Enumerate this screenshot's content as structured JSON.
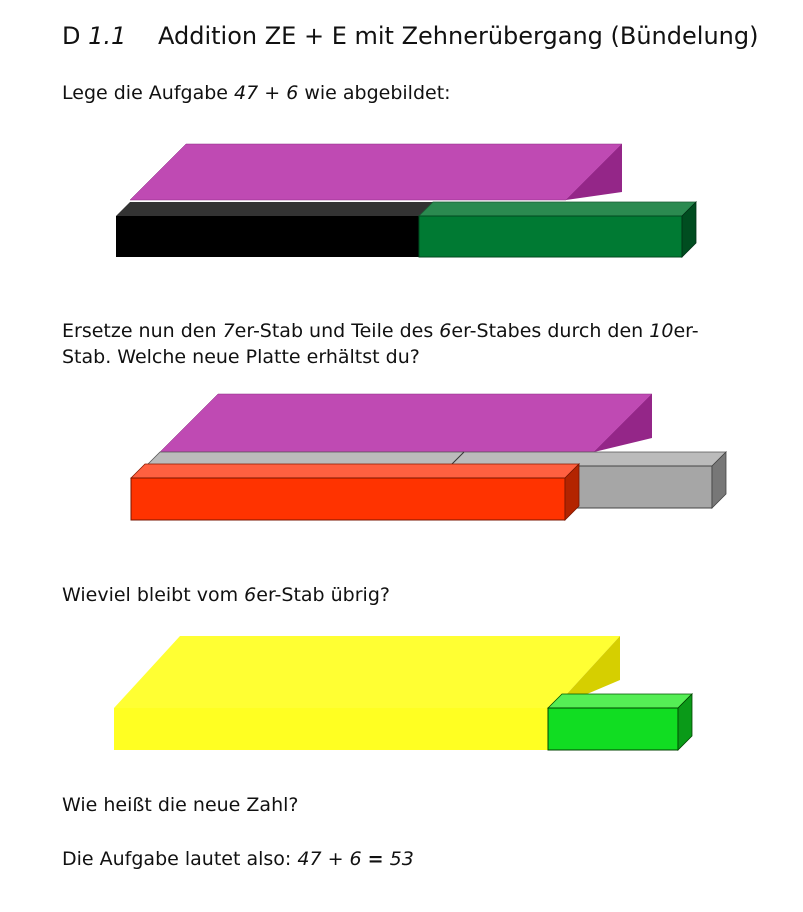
{
  "title": {
    "code_letter": "D",
    "code_number": "1.1",
    "text": "Addition ZE + E mit Zehnerübergang (Bündelung)"
  },
  "step1": {
    "instruction_prefix": "Lege die Aufgabe",
    "task": "47 + 6",
    "instruction_suffix": "wie abgebildet:"
  },
  "step2": {
    "line1_prefix": "Ersetze nun den",
    "seven": "7",
    "line1_mid": "er-Stab und Teile des",
    "six": "6",
    "line1_mid2": "er-Stabes durch den",
    "ten": "10",
    "line1_suffix": "er-",
    "line2": "Stab. Welche neue Platte erhältst du?"
  },
  "step3": {
    "question_prefix": "Wieviel bleibt vom",
    "six": "6",
    "question_suffix": "er-Stab übrig?"
  },
  "step4": {
    "question": "Wie heißt die neue Zahl?"
  },
  "result": {
    "prefix": "Die Aufgabe lautet also:",
    "task": "47 + 6",
    "equals": "=",
    "answer": "53"
  },
  "colors": {
    "ten_plate": "#bf4ab3",
    "seven_rod": "#000000",
    "six_rod": "#007a33",
    "ten_rod": "#ff3300",
    "grey_rod": "#a6a6a6",
    "yellow_plate": "#ffff33",
    "one_rod": "#11dd22"
  }
}
